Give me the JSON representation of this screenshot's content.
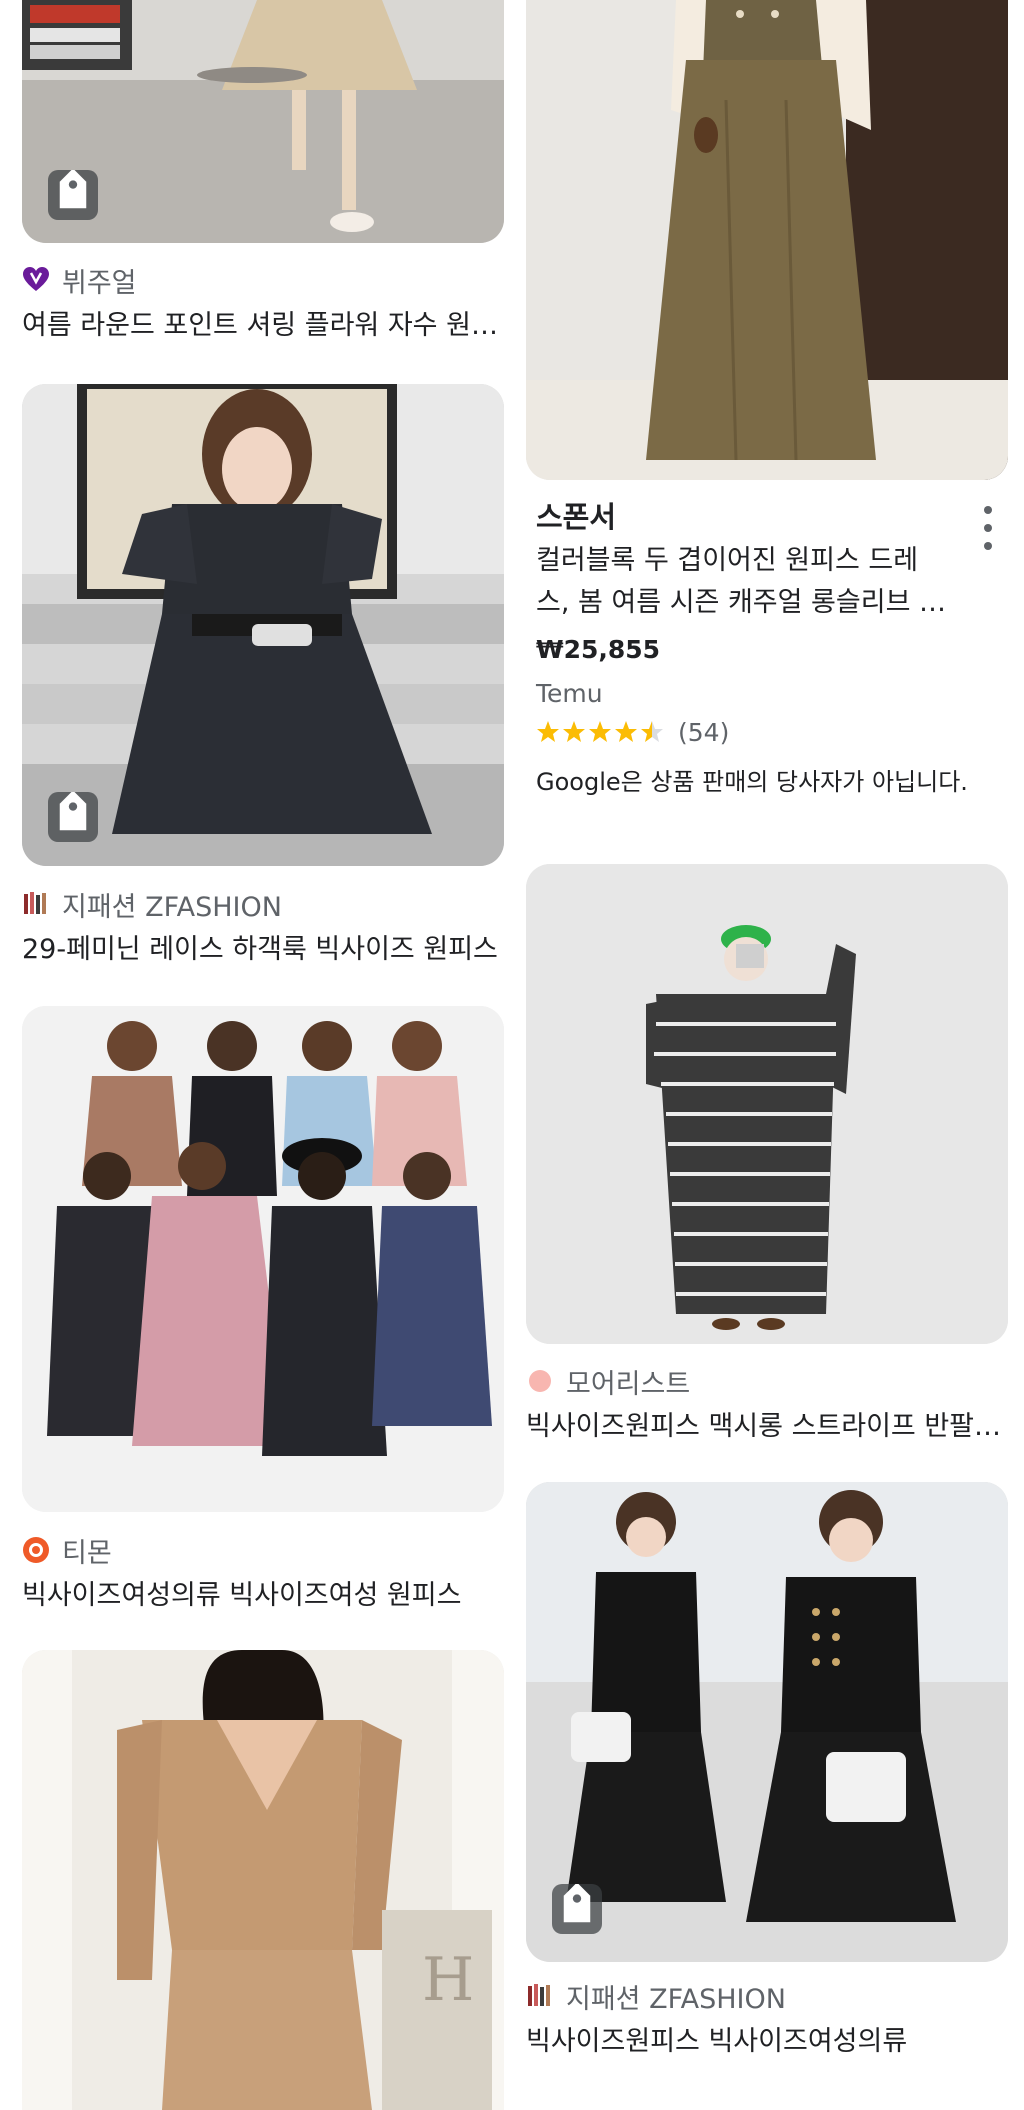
{
  "results": {
    "left": [
      {
        "merchant": "뷔주얼",
        "title": "여름 라운드 포인트 셔링 플라워 자수 원피스",
        "logo_icon": "heart-logo-icon"
      },
      {
        "merchant": "지패션 ZFASHION",
        "title": "29-페미닌 레이스 하객룩 빅사이즈 원피스",
        "logo_icon": "zfashion-logo-icon"
      },
      {
        "merchant": "티몬",
        "title": "빅사이즈여성의류 빅사이즈여성 원피스",
        "logo_icon": "tmon-logo-icon"
      }
    ],
    "sponsored": {
      "label": "스폰서",
      "title_line1": "컬러블록 두 겹이어진 원피스 드레",
      "title_line2": "스, 봄 여름 시즌 캐주얼 롱슬리브 원피스",
      "price": "₩25,855",
      "store": "Temu",
      "rating": 4.5,
      "reviews": "(54)",
      "disclaimer": "Google은 상품 판매의 당사자가 아닙니다."
    },
    "right": [
      {
        "merchant": "모어리스트",
        "title": "빅사이즈원피스 맥시롱 스트라이프 반팔 원피스",
        "logo_icon": "moreist-logo-icon"
      },
      {
        "merchant": "지패션 ZFASHION",
        "title": "빅사이즈원피스 빅사이즈여성의류",
        "logo_icon": "zfashion-logo-icon"
      }
    ]
  },
  "colors": {
    "star": "#fbbc04",
    "tmon_logo": "#ef5a28",
    "heart_logo": "#6a1b9a",
    "moreist_logo": "#f8b6b0"
  }
}
